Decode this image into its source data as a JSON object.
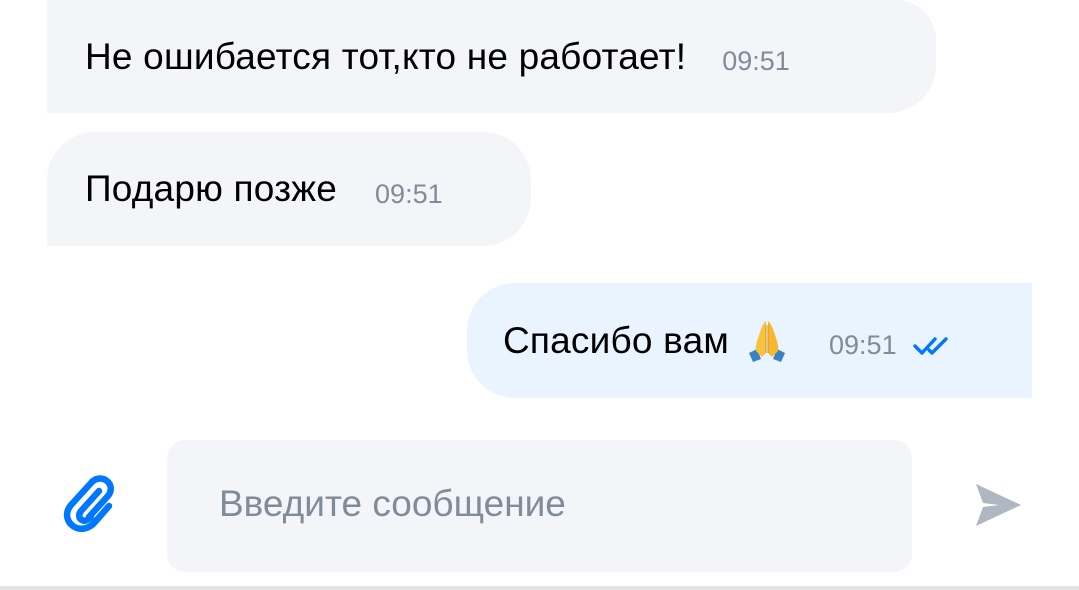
{
  "messages": [
    {
      "direction": "incoming",
      "text": "Не ошибается тот,кто не работает!",
      "time": "09:51"
    },
    {
      "direction": "incoming",
      "text": "Подарю позже",
      "time": "09:51"
    },
    {
      "direction": "outgoing",
      "text": "Спасибо вам",
      "emoji": "folded-hands-emoji",
      "time": "09:51",
      "status_icon": "double-check-icon"
    }
  ],
  "composer": {
    "placeholder": "Введите сообщение",
    "value": "",
    "attach_icon": "paperclip-icon",
    "send_icon": "send-arrow-icon"
  },
  "colors": {
    "incoming_bubble": "#f4f5f8",
    "outgoing_bubble": "#e9f4fe",
    "time_text": "#818c99",
    "accent": "#0077ff",
    "send_icon": "#aeb7c2"
  }
}
